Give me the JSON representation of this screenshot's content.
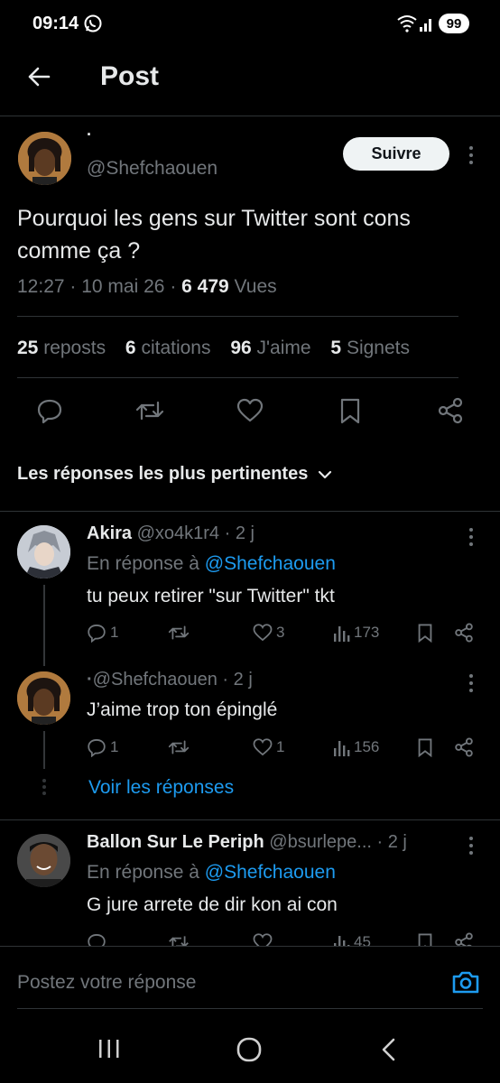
{
  "status_bar": {
    "time": "09:14",
    "battery": "99"
  },
  "header": {
    "title": "Post"
  },
  "post": {
    "display_name": "·",
    "handle": "@Shefchaouen",
    "follow_label": "Suivre",
    "text_line1": "Pourquoi les gens sur Twitter sont cons",
    "text_line2": "comme ça ?",
    "time": "12:27",
    "date": "10 mai 26",
    "views_count": "6 479",
    "views_label": "Vues",
    "stats": {
      "reposts_count": "25",
      "reposts_label": "reposts",
      "quotes_count": "6",
      "quotes_label": "citations",
      "likes_count": "96",
      "likes_label": "J'aime",
      "bookmarks_count": "5",
      "bookmarks_label": "Signets"
    }
  },
  "replies_sort": {
    "label": "Les réponses les plus pertinentes"
  },
  "replies": [
    {
      "name": "Akira",
      "handle": "@xo4k1r4",
      "age": "2 j",
      "reply_to_prefix": "En réponse à",
      "reply_to": "@Shefchaouen",
      "text": "tu peux retirer \"sur Twitter\" tkt",
      "comments": "1",
      "reposts": "",
      "likes": "3",
      "views": "173"
    },
    {
      "name": "·",
      "handle": "@Shefchaouen",
      "age": "2 j",
      "text": "J’aime trop ton épinglé",
      "comments": "1",
      "reposts": "",
      "likes": "1",
      "views": "156"
    },
    {
      "name": "Ballon Sur Le Periph",
      "handle": "@bsurlepe...",
      "age": "2 j",
      "reply_to_prefix": "En réponse à",
      "reply_to": "@Shefchaouen",
      "text": "G jure arrete de dir kon ai con",
      "views": "45"
    }
  ],
  "see_replies": {
    "label": "Voir les réponses"
  },
  "compose": {
    "placeholder": "Postez votre réponse"
  },
  "colors": {
    "accent": "#1d9bf0",
    "background": "#000000",
    "muted": "#71767b",
    "divider": "#2f3336"
  }
}
